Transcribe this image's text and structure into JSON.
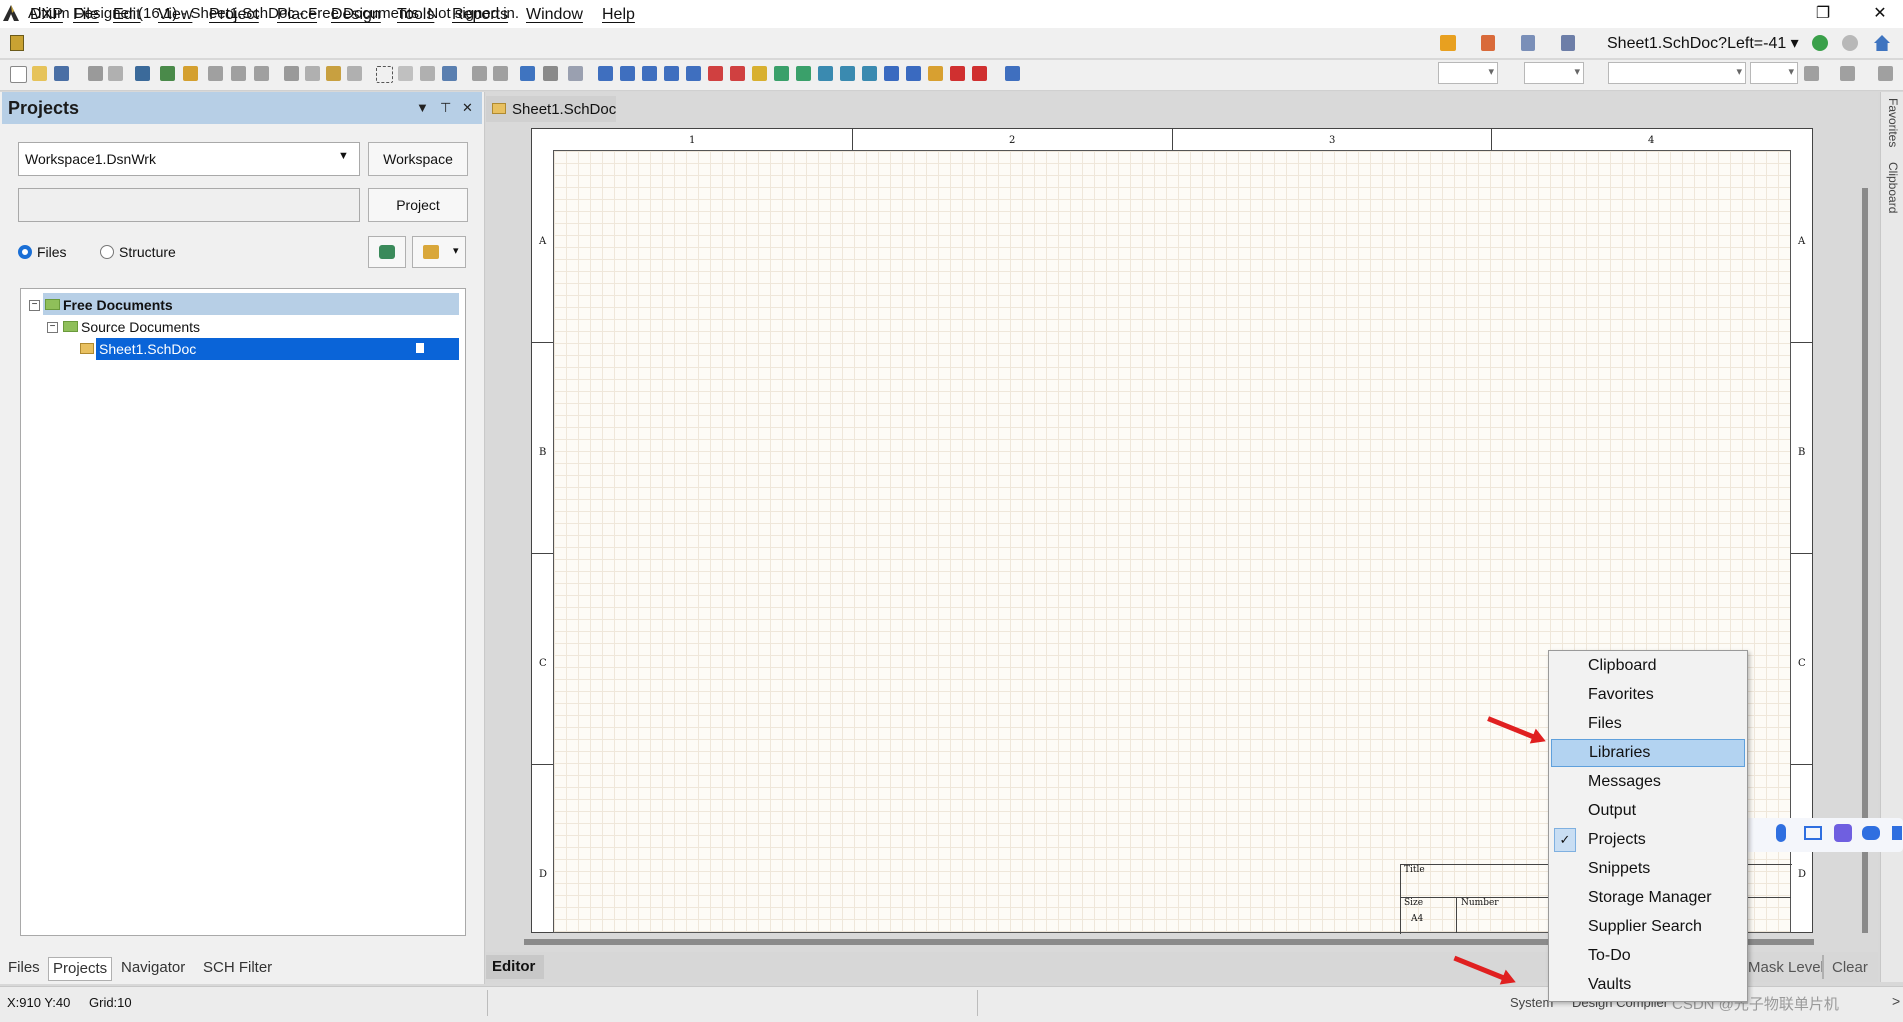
{
  "window": {
    "title": "Altium Designer (16.1) - Sheet1.SchDoc - Free Documents. Not signed in.",
    "restore_glyph": "❐",
    "close_glyph": "✕"
  },
  "menu": [
    "DXP",
    "File",
    "Edit",
    "View",
    "Project",
    "Place",
    "Design",
    "Tools",
    "Reports",
    "Window",
    "Help"
  ],
  "toolbar": {
    "document_address": "Sheet1.SchDoc?Left=-41 ▾"
  },
  "projects_panel": {
    "title": "Projects",
    "workspace_select": "Workspace1.DsnWrk",
    "workspace_button": "Workspace",
    "project_button": "Project",
    "radio_files": "Files",
    "radio_structure": "Structure",
    "tree": {
      "root": "Free Documents",
      "group": "Source Documents",
      "file": "Sheet1.SchDoc"
    },
    "bottom_tabs": [
      "Files",
      "Projects",
      "Navigator",
      "SCH Filter"
    ]
  },
  "editor": {
    "doc_tab": "Sheet1.SchDoc",
    "column_zones": [
      "1",
      "2",
      "3",
      "4"
    ],
    "row_zones": [
      "A",
      "B",
      "C",
      "D"
    ],
    "title_block": {
      "title": "Title",
      "size": "Size",
      "size_value": "A4",
      "number": "Number"
    },
    "status_label": "Editor",
    "mask_level": "Mask Level",
    "clear": "Clear"
  },
  "right_sidebar": {
    "tabs": [
      "Favorites",
      "Clipboard"
    ]
  },
  "status_bar": {
    "coords": "X:910 Y:40",
    "grid": "Grid:10",
    "system": "System",
    "design_compiler": "Design Compiler",
    "watermark": "CSDN @光子物联单片机",
    "chevron": ">"
  },
  "popup_menu": {
    "items": [
      "Clipboard",
      "Favorites",
      "Files",
      "Libraries",
      "Messages",
      "Output",
      "Projects",
      "Snippets",
      "Storage Manager",
      "Supplier Search",
      "To-Do",
      "Vaults"
    ],
    "highlighted": "Libraries",
    "checked": "Projects",
    "check_glyph": "✓"
  },
  "colors": {
    "panel_header": "#b7cfe6",
    "selection": "#0a64d8",
    "annotation_arrow": "#e02020",
    "menu_highlight": "#b3d3f1"
  }
}
